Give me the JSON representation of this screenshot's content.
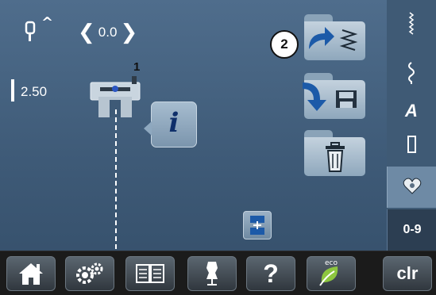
{
  "stitch_settings": {
    "needle_position_caret": "^",
    "offset_left_arrow": "❮",
    "offset_value": "0.0",
    "offset_right_arrow": "❯",
    "stitch_length": "2.50",
    "presser_foot_number": "1"
  },
  "info_button": {
    "glyph": "i"
  },
  "callout": {
    "number": "2"
  },
  "sidebar": {
    "tab_alphabet_label": "A",
    "tab_numbers_label": "0-9"
  },
  "bottom_bar": {
    "help_label": "?",
    "eco_label": "eco",
    "clear_label": "clr"
  },
  "colors": {
    "background": "#4f6d8c",
    "folder": "#c4d2de",
    "bottom_bar": "#1b1b1b",
    "accent_blue": "#0f2f6a",
    "arrow_blue": "#1c5aa8"
  },
  "icons": [
    "needle-icon",
    "presser-foot-icon",
    "info-icon",
    "balance-icon",
    "upload-arrow-icon",
    "zigzag-icon",
    "save-arrow-icon",
    "disk-icon",
    "trash-icon",
    "straight-stitch-icon",
    "decorative-stitch-icon",
    "favorites-heart-icon",
    "home-icon",
    "settings-gears-icon",
    "book-icon",
    "mannequin-icon",
    "eco-leaf-icon"
  ]
}
